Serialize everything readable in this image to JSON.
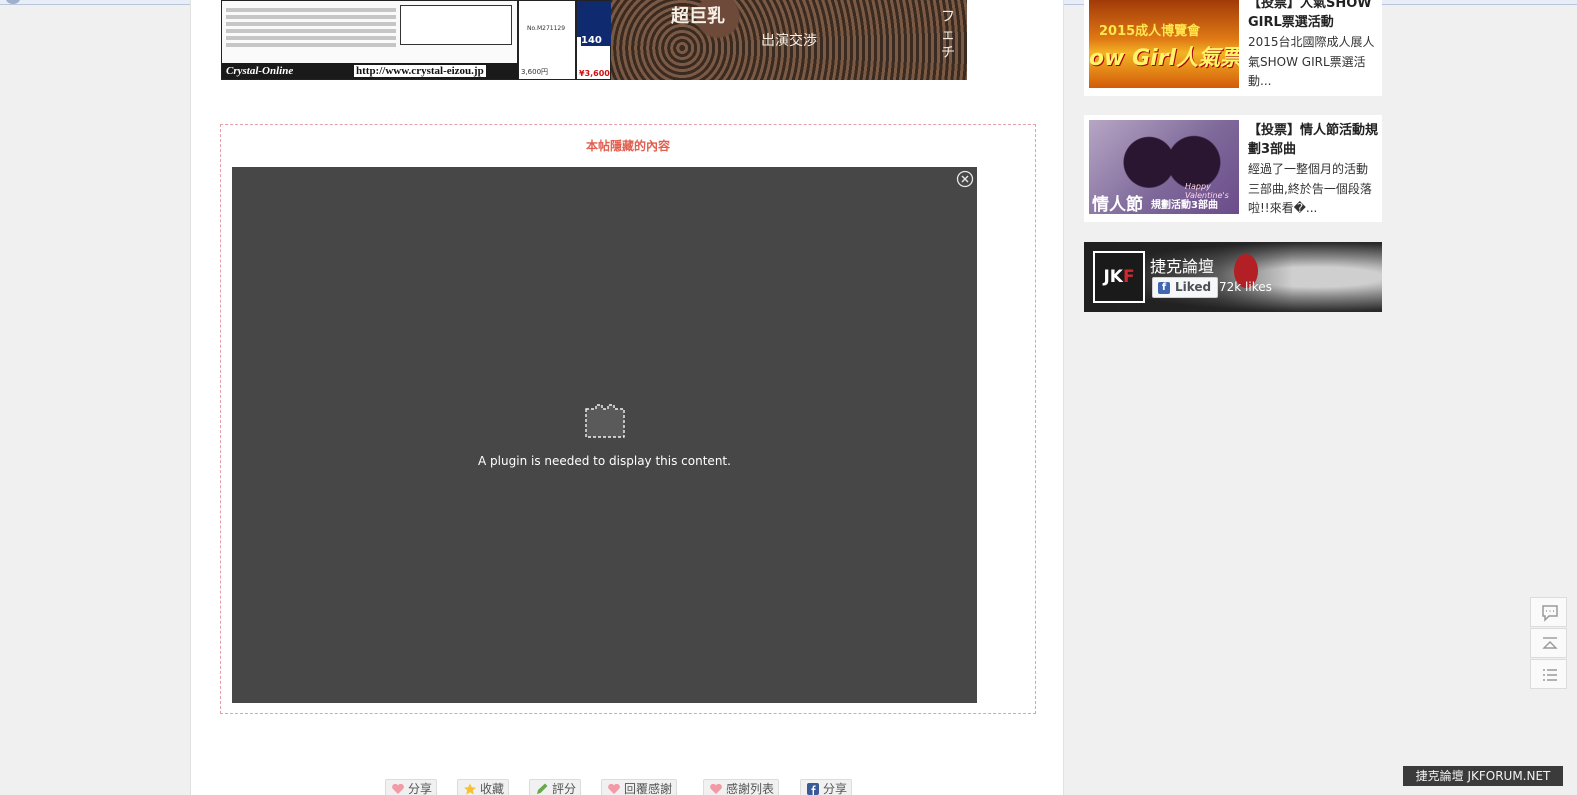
{
  "cover": {
    "brand": "Crystal-Online",
    "url": "http://www.crystal-eizou.jp",
    "product_code": "No.M271129",
    "price_small": "3,600円",
    "spine_number": "140",
    "spine_price": "¥3,600",
    "front_title_1": "超巨乳",
    "front_title_2": "出演交渉",
    "front_side": "フェチ"
  },
  "hidden": {
    "title": "本帖隱藏的內容",
    "plugin_message": "A plugin is needed to display this content."
  },
  "actions": [
    {
      "label": "分享",
      "icon": "heart-icon"
    },
    {
      "label": "收藏",
      "icon": "star-icon"
    },
    {
      "label": "評分",
      "icon": "pencil-icon"
    },
    {
      "label": "回覆感謝",
      "icon": "heart-icon"
    },
    {
      "label": "感謝列表",
      "icon": "heart-icon"
    },
    {
      "label": "分享",
      "icon": "facebook-icon"
    }
  ],
  "sidebar": {
    "card1": {
      "title": "【投票】人氣SHOW GIRL票選活動",
      "desc": "2015台北國際成人展人氣SHOW GIRL票選活動...",
      "thumb_text_1": "2015成人博覽會",
      "thumb_text_2": "ow Girl人氣票"
    },
    "card2": {
      "title": "【投票】情人節活動規劃3部曲",
      "desc": "經過了一整個月的活動三部曲,終於告一個段落啦!!來看�...",
      "thumb_text_1": "情人節",
      "thumb_text_2": "規劃活動3部曲",
      "thumb_text_3": "Happy Valentine's"
    },
    "facebook": {
      "logo_text_1": "JK",
      "logo_text_2": "F",
      "page_name": "捷克論壇",
      "liked_label": "Liked",
      "likes_count": "72k likes"
    }
  },
  "footer_tag": "捷克論壇 JKFORUM.NET",
  "colors": {
    "hidden_title": "#e15f4f",
    "plugin_bg": "#474747",
    "dashed_border": "#e4a1a8",
    "fb_blue": "#4267b2"
  }
}
